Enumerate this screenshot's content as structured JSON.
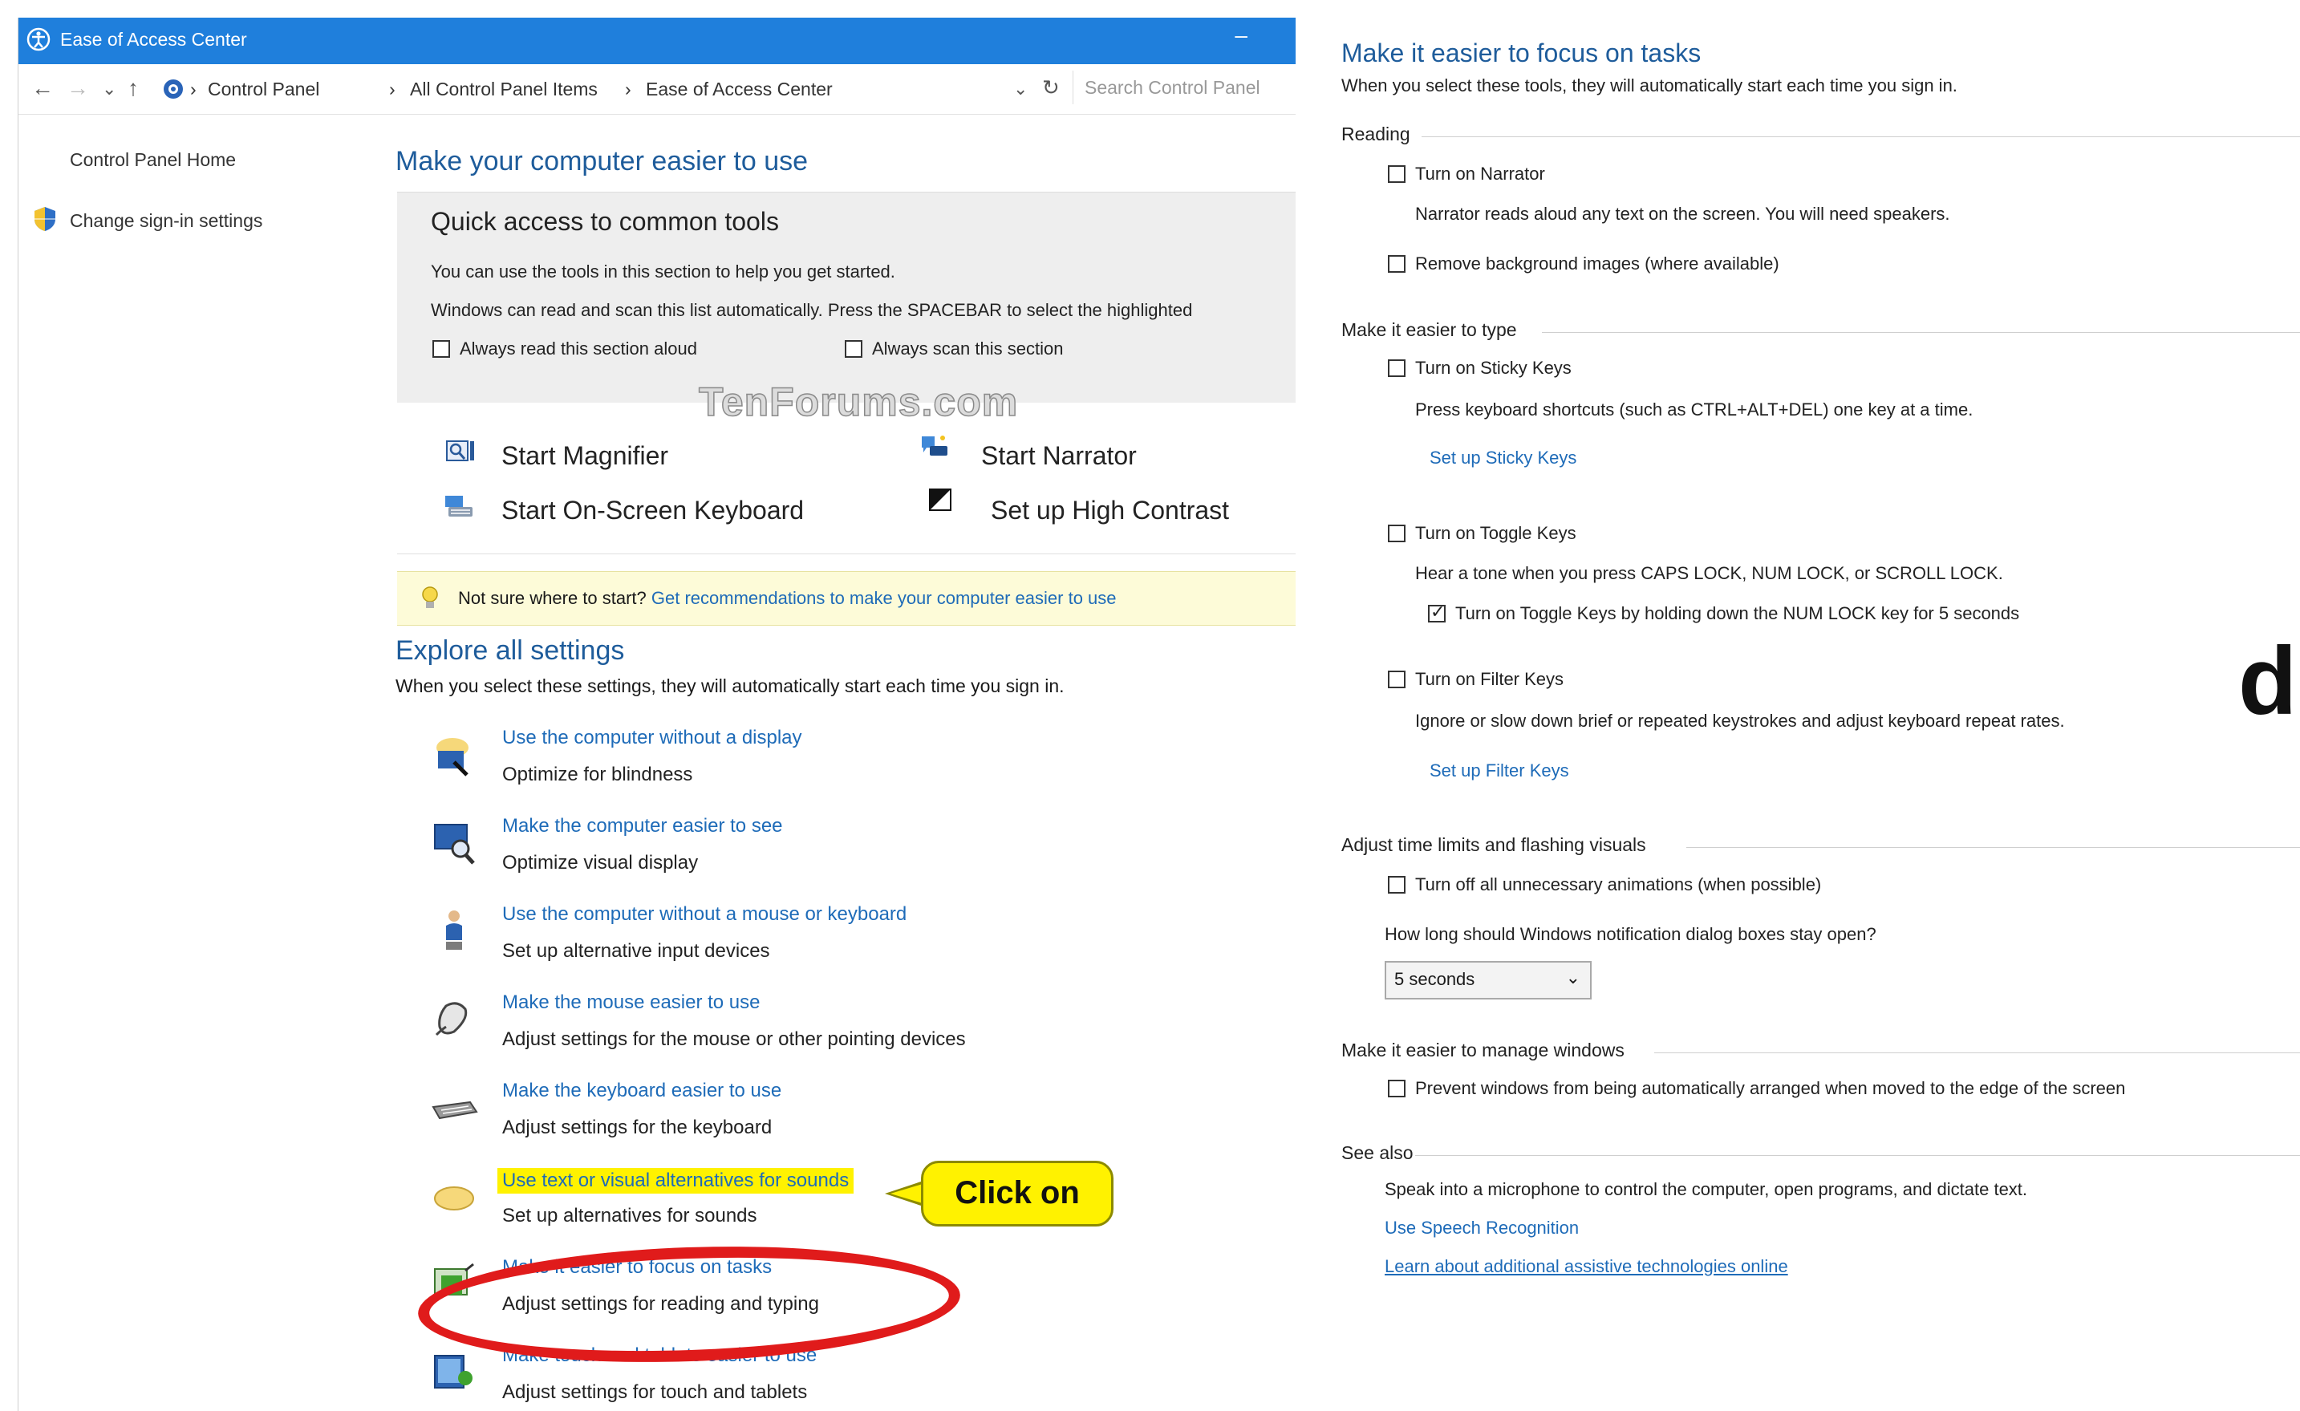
{
  "window": {
    "title": "Ease of Access Center",
    "min_glyph": "–"
  },
  "address": {
    "back": "←",
    "forward": "→",
    "recent": "⌄",
    "up": "↑",
    "breadcrumb": [
      "Control Panel",
      "All Control Panel Items",
      "Ease of Access Center"
    ],
    "separator": "›",
    "dropdown": "⌄",
    "refresh": "↻",
    "search_placeholder": "Search Control Panel"
  },
  "sidebar": {
    "items": [
      {
        "label": "Control Panel Home"
      },
      {
        "label": "Change sign-in settings"
      }
    ]
  },
  "main": {
    "heading": "Make your computer easier to use",
    "quick": {
      "title": "Quick access to common tools",
      "line1": "You can use the tools in this section to help you get started.",
      "line2": "Windows can read and scan this list automatically.  Press the SPACEBAR to select the highlighted",
      "checkbox_read": "Always read this section aloud",
      "checkbox_scan": "Always scan this section"
    },
    "watermark": "TenForums.com",
    "tools": [
      {
        "label": "Start Magnifier",
        "icon": "magnifier-icon"
      },
      {
        "label": "Start Narrator",
        "icon": "narrator-icon"
      },
      {
        "label": "Start On-Screen Keyboard",
        "icon": "keyboard-icon"
      },
      {
        "label": "Set up High Contrast",
        "icon": "contrast-icon"
      }
    ],
    "tip": {
      "prefix": "Not sure where to start?",
      "link": "Get recommendations to make your computer easier to use"
    },
    "explore": {
      "heading": "Explore all settings",
      "subtext": "When you select these settings, they will automatically start each time you sign in."
    },
    "settings": [
      {
        "link": "Use the computer without a display",
        "desc": "Optimize for blindness"
      },
      {
        "link": "Make the computer easier to see",
        "desc": "Optimize visual display"
      },
      {
        "link": "Use the computer without a mouse or keyboard",
        "desc": "Set up alternative input devices"
      },
      {
        "link": "Make the mouse easier to use",
        "desc": "Adjust settings for the mouse or other pointing devices"
      },
      {
        "link": "Make the keyboard easier to use",
        "desc": "Adjust settings for the keyboard"
      },
      {
        "link": "Use text or visual alternatives for sounds",
        "desc": "Set up alternatives for sounds"
      },
      {
        "link": "Make it easier to focus on tasks",
        "desc": "Adjust settings for reading and typing"
      },
      {
        "link": "Make touch and tablets easier to use",
        "desc": "Adjust settings for touch and tablets"
      }
    ],
    "callout": "Click on"
  },
  "right": {
    "title": "Make it easier to focus on tasks",
    "subtitle": "When you select these tools, they will automatically start each time you sign in.",
    "reading": {
      "group": "Reading",
      "narrator": "Turn on Narrator",
      "narrator_desc": "Narrator reads aloud any text on the screen. You will need speakers.",
      "remove_bg": "Remove background images (where available)"
    },
    "typing": {
      "group": "Make it easier to type",
      "sticky": "Turn on Sticky Keys",
      "sticky_desc": "Press keyboard shortcuts (such as CTRL+ALT+DEL) one key at a time.",
      "sticky_link": "Set up Sticky Keys",
      "toggle": "Turn on Toggle Keys",
      "toggle_desc": "Hear a tone when you press CAPS LOCK, NUM LOCK, or SCROLL LOCK.",
      "toggle_hold": "Turn on Toggle Keys by holding down the NUM LOCK key for 5 seconds",
      "filter": "Turn on Filter Keys",
      "filter_desc": "Ignore or slow down brief or repeated keystrokes and adjust keyboard repeat rates.",
      "filter_link": "Set up Filter Keys"
    },
    "time": {
      "group": "Adjust time limits and flashing visuals",
      "animations": "Turn off all unnecessary animations (when possible)",
      "question": "How long should Windows notification dialog boxes stay open?",
      "dropdown_value": "5 seconds",
      "dropdown_arrow": "⌄"
    },
    "windows": {
      "group": "Make it easier to manage windows",
      "prevent": "Prevent windows from being automatically arranged when moved to the edge of the screen"
    },
    "see_also": {
      "group": "See also",
      "speak": "Speak into a microphone to control the computer, open programs, and dictate text.",
      "speech_link": "Use Speech Recognition",
      "learn_link": "Learn about additional assistive technologies online"
    },
    "edge_glyph": "d"
  },
  "colors": {
    "titlebar": "#1f7fdc",
    "link": "#1e6bb8",
    "heading": "#1e5c9b",
    "highlight": "#fff200",
    "ellipse": "#e01b1b"
  }
}
